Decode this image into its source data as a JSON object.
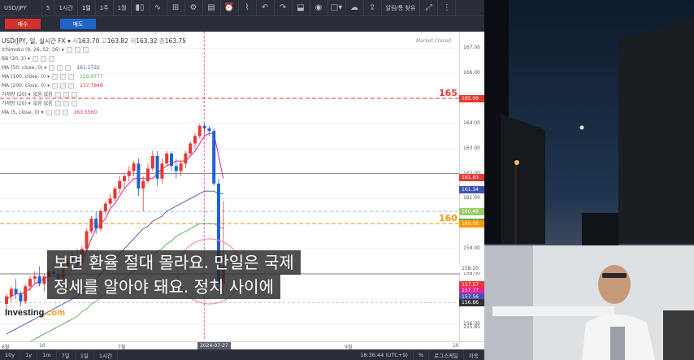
{
  "toolbar": {
    "symbol": "USD/JPY",
    "intervals": [
      "5",
      "1시간",
      "1일",
      "1주",
      "1월"
    ],
    "active_interval": "1일",
    "options_label": "알림/통 찾유"
  },
  "trade": {
    "buy_label": "매수",
    "sell_label": "매도"
  },
  "legend": {
    "symbol_line": "USD/JPY, 일, 실시간 FX",
    "ohlc": {
      "o_label": "시",
      "o": "163.70",
      "h_label": "고",
      "h": "163.82",
      "l_label": "저",
      "l": "163.32",
      "c_label": "종",
      "c": "163.75"
    },
    "indicators": [
      {
        "name": "Ichimoku (9, 26, 52, 26)",
        "value": "",
        "color": "#777777"
      },
      {
        "name": "BB (20, 2)",
        "value": "",
        "color": "#777777"
      },
      {
        "name": "MA (50, close, 0)",
        "value": "161.1722",
        "color": "#3f51b5"
      },
      {
        "name": "MA (100, close, 0)",
        "value": "159.9777",
        "color": "#4caf50"
      },
      {
        "name": "MA (200, close, 0)",
        "value": "157.7848",
        "color": "#e53935"
      },
      {
        "name": "거래량 (20)",
        "value": "",
        "color": "#777777",
        "extra": "없음  없음"
      },
      {
        "name": "거래량 (20)",
        "value": "",
        "color": "#777777",
        "extra": "없음  없음"
      },
      {
        "name": "MA (5, close, 0)",
        "value": "163.5560",
        "color": "#e91e8c"
      }
    ],
    "market_status": "Market Closed"
  },
  "chart_data": {
    "type": "candlestick",
    "symbol": "USD/JPY",
    "ylim": [
      155.6,
      167.4
    ],
    "y_ticks": [
      "167.00",
      "166.00",
      "165.00",
      "164.00",
      "163.00",
      "162.00",
      "161.00",
      "160.00",
      "159.00",
      "158.00",
      "157.00",
      "156.00",
      "155.85"
    ],
    "x_ticks": [
      "6월",
      "10",
      "7월",
      "9월",
      "10"
    ],
    "cursor_date": "2024-07-27",
    "levels": [
      {
        "label": "165",
        "price": 165.0,
        "color": "#e53935"
      },
      {
        "label": "160",
        "price": 160.0,
        "color": "#ff9800"
      }
    ],
    "price_tags": [
      {
        "text": "165.00",
        "price": 165.0,
        "bg": "#e53935"
      },
      {
        "text": "161.83",
        "price": 161.83,
        "bg": "#e53935"
      },
      {
        "text": "161.34",
        "price": 161.34,
        "bg": "#3f51b5"
      },
      {
        "text": "160.49",
        "price": 160.49,
        "bg": "#9ccc65"
      },
      {
        "text": "160.06",
        "price": 160.06,
        "bg": "#4caf50"
      },
      {
        "text": "160.00",
        "price": 160.0,
        "bg": "#ff9800"
      },
      {
        "text": "158.20",
        "price": 158.2,
        "bg": "#ffffff",
        "fg": "#555"
      },
      {
        "text": "157.57",
        "price": 157.57,
        "bg": "#e53935"
      },
      {
        "text": "157.77",
        "price": 157.34,
        "bg": "#e91e8c"
      },
      {
        "text": "157.56",
        "price": 157.08,
        "bg": "#3f51b5"
      },
      {
        "text": "156.86",
        "price": 156.86,
        "bg": "#333333"
      }
    ],
    "candles": [
      [
        156.8,
        157.2,
        156.5,
        157.1
      ],
      [
        157.1,
        157.5,
        156.9,
        157.4
      ],
      [
        157.4,
        157.8,
        157.0,
        157.2
      ],
      [
        157.2,
        157.3,
        156.7,
        156.9
      ],
      [
        156.9,
        157.6,
        156.8,
        157.5
      ],
      [
        157.5,
        157.9,
        157.3,
        157.8
      ],
      [
        157.8,
        158.1,
        157.6,
        157.9
      ],
      [
        157.9,
        158.3,
        157.5,
        157.6
      ],
      [
        157.6,
        158.0,
        157.3,
        157.9
      ],
      [
        157.9,
        158.2,
        157.7,
        158.1
      ],
      [
        158.1,
        158.5,
        157.9,
        158.0
      ],
      [
        158.0,
        158.2,
        157.6,
        157.8
      ],
      [
        157.8,
        158.4,
        157.7,
        158.3
      ],
      [
        158.3,
        158.6,
        158.1,
        158.5
      ],
      [
        158.5,
        158.9,
        158.4,
        158.7
      ],
      [
        158.7,
        159.0,
        158.3,
        158.4
      ],
      [
        158.4,
        159.1,
        158.2,
        159.0
      ],
      [
        159.0,
        159.8,
        158.9,
        159.7
      ],
      [
        159.7,
        160.3,
        159.6,
        160.2
      ],
      [
        160.2,
        160.5,
        159.6,
        159.8
      ],
      [
        159.8,
        160.6,
        159.7,
        160.5
      ],
      [
        160.5,
        160.9,
        160.4,
        160.8
      ],
      [
        160.8,
        161.2,
        160.7,
        161.0
      ],
      [
        161.0,
        161.5,
        160.9,
        161.4
      ],
      [
        161.4,
        161.9,
        161.2,
        161.7
      ],
      [
        161.7,
        162.0,
        161.4,
        161.9
      ],
      [
        161.9,
        162.3,
        161.7,
        162.1
      ],
      [
        162.1,
        162.5,
        161.9,
        162.4
      ],
      [
        162.4,
        162.6,
        161.1,
        161.4
      ],
      [
        161.4,
        161.9,
        160.5,
        161.7
      ],
      [
        161.7,
        162.4,
        161.6,
        162.2
      ],
      [
        162.2,
        162.9,
        162.1,
        162.7
      ],
      [
        162.7,
        162.9,
        161.5,
        161.8
      ],
      [
        161.8,
        162.6,
        161.6,
        162.4
      ],
      [
        162.4,
        162.9,
        162.3,
        162.8
      ],
      [
        162.8,
        162.9,
        162.1,
        162.3
      ],
      [
        162.3,
        162.6,
        161.8,
        162.1
      ],
      [
        162.1,
        162.5,
        161.9,
        162.4
      ],
      [
        162.4,
        162.9,
        162.2,
        162.8
      ],
      [
        162.8,
        163.3,
        162.7,
        163.2
      ],
      [
        163.2,
        163.6,
        163.0,
        163.5
      ],
      [
        163.5,
        164.0,
        163.4,
        163.9
      ],
      [
        163.9,
        164.0,
        163.6,
        163.8
      ],
      [
        163.8,
        163.9,
        163.5,
        163.7
      ],
      [
        163.7,
        163.8,
        161.5,
        161.6
      ],
      [
        161.6,
        161.8,
        157.3,
        157.6
      ],
      [
        157.6,
        160.9,
        157.1,
        158.3
      ]
    ],
    "ma5": [
      157.0,
      157.1,
      157.2,
      157.2,
      157.3,
      157.4,
      157.6,
      157.7,
      157.8,
      157.9,
      157.9,
      157.9,
      157.9,
      158.0,
      158.2,
      158.3,
      158.6,
      158.9,
      159.4,
      159.8,
      160.0,
      160.2,
      160.6,
      160.8,
      161.1,
      161.4,
      161.6,
      161.8,
      161.8,
      161.8,
      161.8,
      161.8,
      162.0,
      162.2,
      162.3,
      162.4,
      162.5,
      162.5,
      162.5,
      162.7,
      162.9,
      163.2,
      163.5,
      163.6,
      163.6,
      162.7,
      161.8
    ],
    "ma50": [
      155.6,
      155.7,
      155.8,
      155.9,
      156.0,
      156.1,
      156.2,
      156.3,
      156.4,
      156.5,
      156.6,
      156.7,
      156.8,
      156.9,
      157.0,
      157.1,
      157.3,
      157.4,
      157.6,
      157.8,
      158.0,
      158.2,
      158.4,
      158.6,
      158.8,
      159.0,
      159.2,
      159.4,
      159.6,
      159.8,
      159.9,
      160.1,
      160.2,
      160.3,
      160.5,
      160.6,
      160.7,
      160.8,
      160.9,
      161.0,
      161.1,
      161.2,
      161.3,
      161.3,
      161.3,
      161.2,
      161.2
    ],
    "ma100": [
      154.8,
      154.9,
      155.0,
      155.1,
      155.2,
      155.3,
      155.4,
      155.5,
      155.6,
      155.7,
      155.8,
      155.9,
      156.0,
      156.1,
      156.2,
      156.3,
      156.5,
      156.6,
      156.8,
      156.9,
      157.1,
      157.2,
      157.4,
      157.5,
      157.7,
      157.8,
      158.0,
      158.1,
      158.3,
      158.4,
      158.6,
      158.7,
      158.9,
      159.0,
      159.2,
      159.3,
      159.5,
      159.6,
      159.7,
      159.8,
      159.9,
      160.0,
      160.0,
      160.0,
      160.0,
      159.9,
      159.8
    ]
  },
  "bottom": {
    "ranges": [
      "10y",
      "1y",
      "1m",
      "7일",
      "1일",
      "1시간"
    ],
    "clock": "18:36:44 (UTC+9)",
    "percent": "%",
    "log": "로그스케일",
    "auto": "자동"
  },
  "subtitle": {
    "line1": "보면 환율 절대 몰라요. 만일은 국제",
    "line2": "정세를 알아야 돼요. 정치 사이에"
  },
  "branding": {
    "logo_text": "Investing",
    "logo_dot": ".com"
  }
}
